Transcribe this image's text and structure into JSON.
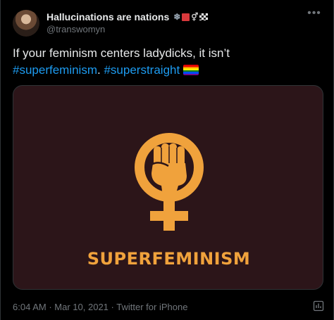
{
  "tweet": {
    "display_name": "Hallucinations are nations",
    "handle": "@transwomyn",
    "text_line1": "If your feminism centers ladydicks, it isn’t",
    "hashtag1": "#superfeminism",
    "separator": ".",
    "hashtag2": "#superstraight"
  },
  "media": {
    "caption": "SUPERFEMINISM",
    "background_color": "#2c1519",
    "accent_color": "#f0a23c"
  },
  "meta": {
    "time": "6:04 AM",
    "date": "Mar 10, 2021",
    "source": "Twitter for iPhone",
    "dot": "·"
  },
  "icons": {
    "name_emojis": [
      "snowflake-icon",
      "red-square-icon",
      "gender-symbol-icon",
      "checkered-flag-icon"
    ],
    "hashtag_emoji": "rainbow-flag-icon",
    "more": "more-icon",
    "analytics": "analytics-icon"
  }
}
